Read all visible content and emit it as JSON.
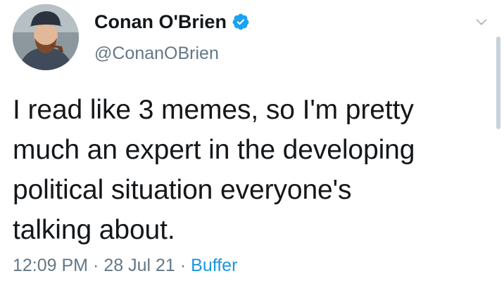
{
  "tweet": {
    "author": {
      "display_name": "Conan O'Brien",
      "handle": "@ConanOBrien",
      "verified": true,
      "avatar_icon": "profile-photo"
    },
    "text_lines": [
      "I read like 3 memes, so I'm pretty",
      "much an expert in the developing",
      "political situation everyone's",
      "talking about."
    ],
    "meta": {
      "time": "12:09 PM",
      "date": "28 Jul 21",
      "separator": "·",
      "source": "Buffer"
    },
    "menu_icon": "chevron-down-icon"
  },
  "colors": {
    "text": "#14171a",
    "secondary_text": "#657786",
    "link": "#1b95e0",
    "verified_badge": "#1da1f2"
  }
}
